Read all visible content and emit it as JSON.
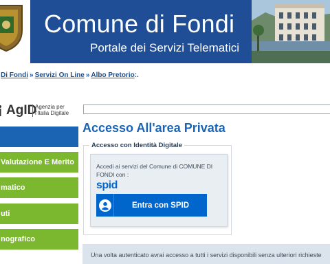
{
  "header": {
    "title": "Comune di Fondi",
    "subtitle": "Portale dei Servizi Telematici",
    "crest_icon": "city-crest-icon",
    "photo": "town-hall-photo",
    "colors": {
      "banner": "#1f4d96"
    }
  },
  "breadcrumb": {
    "items": [
      "Di Fondi",
      "Servizi On Line",
      "Albo Pretorio"
    ],
    "separator": "»",
    "trailing": ":."
  },
  "agid": {
    "name": "AgID",
    "tagline_1": "Agenzia per",
    "tagline_2": "l'Italia Digitale"
  },
  "search": {
    "value": "",
    "placeholder": ""
  },
  "sidebar": {
    "items": [
      {
        "label": ""
      },
      {
        "label": "Valutazione E Merito"
      },
      {
        "label": "matico"
      },
      {
        "label": "uti"
      },
      {
        "label": "nografico"
      }
    ],
    "colors": {
      "active": "#1b64b3",
      "item": "#7cb82f"
    }
  },
  "main": {
    "title": "Accesso All'area Privata",
    "section_legend": "Accesso con Identità Digitale",
    "description": "Accedi ai servizi del Comune di COMUNE DI FONDI con :",
    "spid_logo": "spid",
    "spid_button": "Entra con SPID",
    "info": "Una volta autenticato avrai accesso a tutti i servizi disponibili senza ulteriori richieste",
    "colors": {
      "accent": "#0066cc",
      "title": "#1b64b3"
    }
  }
}
